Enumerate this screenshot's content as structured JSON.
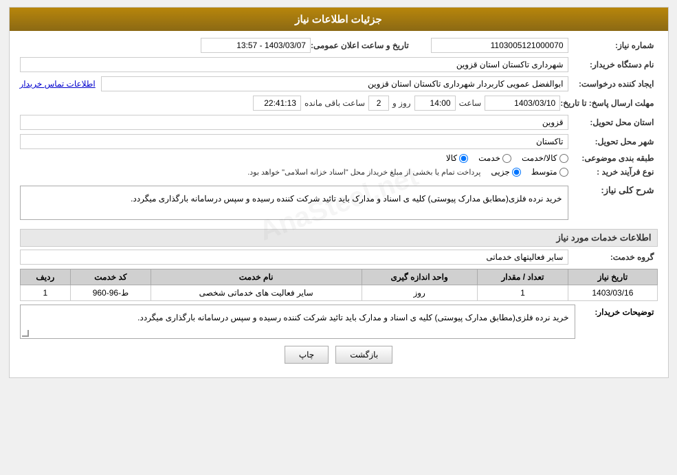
{
  "header": {
    "title": "جزئیات اطلاعات نیاز"
  },
  "fields": {
    "need_number_label": "شماره نیاز:",
    "need_number_value": "1103005121000070",
    "announcement_date_label": "تاریخ و ساعت اعلان عمومی:",
    "announcement_date_value": "1403/03/07 - 13:57",
    "buyer_name_label": "نام دستگاه خریدار:",
    "buyer_name_value": "شهرداری تاکستان استان قزوین",
    "creator_label": "ایجاد کننده درخواست:",
    "creator_value": "ابوالفضل عمویی کاربردار شهرداری تاکستان استان قزوین",
    "contact_link": "اطلاعات تماس خریدار",
    "reply_deadline_label": "مهلت ارسال پاسخ: تا تاریخ:",
    "deadline_date": "1403/03/10",
    "deadline_time_label": "ساعت",
    "deadline_time": "14:00",
    "remaining_label": "روز و",
    "remaining_days": "2",
    "remaining_time_label": "ساعت باقی مانده",
    "remaining_time": "22:41:13",
    "province_label": "استان محل تحویل:",
    "province_value": "قزوین",
    "city_label": "شهر محل تحویل:",
    "city_value": "تاکستان",
    "category_label": "طبقه بندی موضوعی:",
    "category_kala": "کالا",
    "category_khedmat": "خدمت",
    "category_kala_khedmat": "کالا/خدمت",
    "purchase_type_label": "نوع فرآیند خرید :",
    "purchase_jozii": "جزیی",
    "purchase_motaset": "متوسط",
    "purchase_note": "پرداخت تمام یا بخشی از مبلغ خریداز محل \"اسناد خزانه اسلامی\" خواهد بود.",
    "general_desc_label": "شرح کلی نیاز:",
    "general_desc_text": "خرید نرده فلزی(مطابق مدارک پیوستی) کلیه ی اسناد و مدارک باید تائید شرکت کننده رسیده و سپس درسامانه بارگذاری میگردد.",
    "services_title": "اطلاعات خدمات مورد نیاز",
    "service_group_label": "گروه خدمت:",
    "service_group_value": "سایر فعالیتهای خدماتی",
    "table": {
      "col_row": "ردیف",
      "col_code": "کد خدمت",
      "col_name": "نام خدمت",
      "col_unit": "واحد اندازه گیری",
      "col_quantity": "تعداد / مقدار",
      "col_date": "تاریخ نیاز",
      "rows": [
        {
          "row": "1",
          "code": "ط-96-960",
          "name": "سایر فعالیت های خدماتی شخصی",
          "unit": "روز",
          "quantity": "1",
          "date": "1403/03/16"
        }
      ]
    },
    "buyer_desc_label": "توضیحات خریدار:",
    "buyer_desc_text": "خرید نرده فلزی(مطابق مدارک پیوستی) کلیه ی اسناد و مدارک باید تائید شرکت کننده رسیده و سپس درسامانه بارگذاری میگردد."
  },
  "buttons": {
    "print": "چاپ",
    "back": "بازگشت"
  }
}
